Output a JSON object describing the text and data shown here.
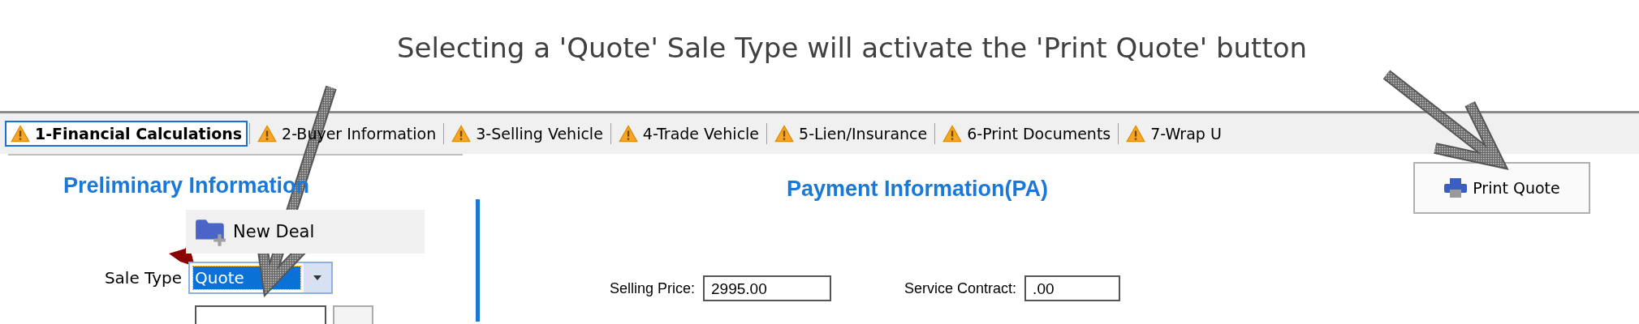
{
  "caption": "Selecting a 'Quote' Sale Type will activate the 'Print Quote' button",
  "tabs": [
    {
      "label": "1-Financial Calculations",
      "selected": true
    },
    {
      "label": "2-Buyer Information",
      "selected": false
    },
    {
      "label": "3-Selling Vehicle",
      "selected": false
    },
    {
      "label": "4-Trade Vehicle",
      "selected": false
    },
    {
      "label": "5-Lien/Insurance",
      "selected": false
    },
    {
      "label": "6-Print Documents",
      "selected": false
    },
    {
      "label": "7-Wrap U",
      "selected": false
    }
  ],
  "preliminary": {
    "title": "Preliminary Information",
    "new_deal_button": "New Deal",
    "sale_type": {
      "label": "Sale Type",
      "value": "Quote",
      "required": true
    }
  },
  "payment": {
    "title": "Payment Information(PA)",
    "fields": [
      {
        "label": "Selling Price:",
        "value": "2995.00"
      },
      {
        "label": "Service Contract:",
        "value": ".00"
      }
    ]
  },
  "print_button": "Print Quote"
}
